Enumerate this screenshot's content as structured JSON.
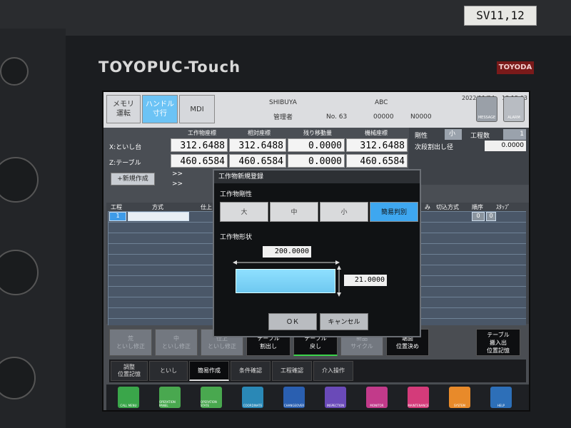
{
  "bezel": {
    "sv_label": "SV11,12",
    "brand": "TOYOPUC-Touch",
    "brand_badge": "TOYODA"
  },
  "header": {
    "btn_memory": "メモリ\n運転",
    "btn_handle": "ハンドル\n寸行",
    "btn_mdi": "MDI",
    "user_name": "SHIBUYA",
    "user_role": "管理者",
    "program_name": "ABC",
    "program_no": "No. 63",
    "seq1": "00000",
    "seq2": "N0000",
    "date": "2022/11/24",
    "time": "13:15:03",
    "icon_message": "MESSAGE",
    "icon_alarm": "ALARM"
  },
  "coords": {
    "headers": [
      "工作物座標",
      "相対座標",
      "残り移動量",
      "機械座標"
    ],
    "rows": [
      {
        "label": "X:といし台",
        "values": [
          "312.6488",
          "312.6488",
          "0.0000",
          "312.6488"
        ]
      },
      {
        "label": "Z:テーブル",
        "values": [
          "460.6584",
          "460.6584",
          "0.0000",
          "460.6584"
        ]
      }
    ]
  },
  "side": {
    "rigidity_label": "剛性",
    "rigidity_value": "小",
    "steps_label": "工程数",
    "steps_value": "1",
    "next_diameter_label": "次段割出し径",
    "next_diameter_value": "0.0000"
  },
  "main": {
    "new_button": "+新規作成",
    "arrow1": ">>",
    "arrow2": ">>",
    "table_headers": [
      "工程",
      "方式",
      "仕上",
      "み",
      "切込方式",
      "順序",
      "ｽﾀｯﾌﾟ"
    ],
    "first_step": "1",
    "order_a": "0",
    "order_b": "0"
  },
  "function_buttons": [
    {
      "label": "荒\nといし修正",
      "active": false
    },
    {
      "label": "中\nといし修正",
      "active": false
    },
    {
      "label": "仕上\nといし修正",
      "active": false
    },
    {
      "label": "テーブル\n割出し",
      "active": true
    },
    {
      "label": "テーブル\n戻し",
      "active": true
    },
    {
      "label": "新品\nサイクル",
      "active": false
    },
    {
      "label": "端面\n位置決め",
      "active": true
    },
    {
      "label": "テーブル\n搬入出\n位置記憶",
      "active": true
    }
  ],
  "tabs": [
    "調整\n位置記憶",
    "といし",
    "簡易作成",
    "条件確認",
    "工程確認",
    "介入操作"
  ],
  "dock_icons": [
    {
      "label": "CALL MENU",
      "color": "#3aa64a"
    },
    {
      "label": "OPERATION PANEL",
      "color": "#49a84f"
    },
    {
      "label": "OPERATION STATE",
      "color": "#49a84f"
    },
    {
      "label": "COORDINATE",
      "color": "#2a88b6"
    },
    {
      "label": "CHANGEOVER",
      "color": "#2a5fb0"
    },
    {
      "label": "INSPECTION",
      "color": "#6a4ab8"
    },
    {
      "label": "MONITOR",
      "color": "#c23a8a"
    },
    {
      "label": "MAINTENANCE",
      "color": "#d43b7a"
    },
    {
      "label": "SYSTEM",
      "color": "#e88a2a"
    },
    {
      "label": "HELP",
      "color": "#2d6fb8"
    }
  ],
  "dialog": {
    "title": "工作物新規登録",
    "rigidity_section": "工作物剛性",
    "choices": [
      "大",
      "中",
      "小",
      "簡易判別"
    ],
    "selected_choice": 3,
    "shape_section": "工作物形状",
    "width_value": "200.0000",
    "height_value": "21.0000",
    "ok_label": "ＯＫ",
    "cancel_label": "キャンセル"
  }
}
